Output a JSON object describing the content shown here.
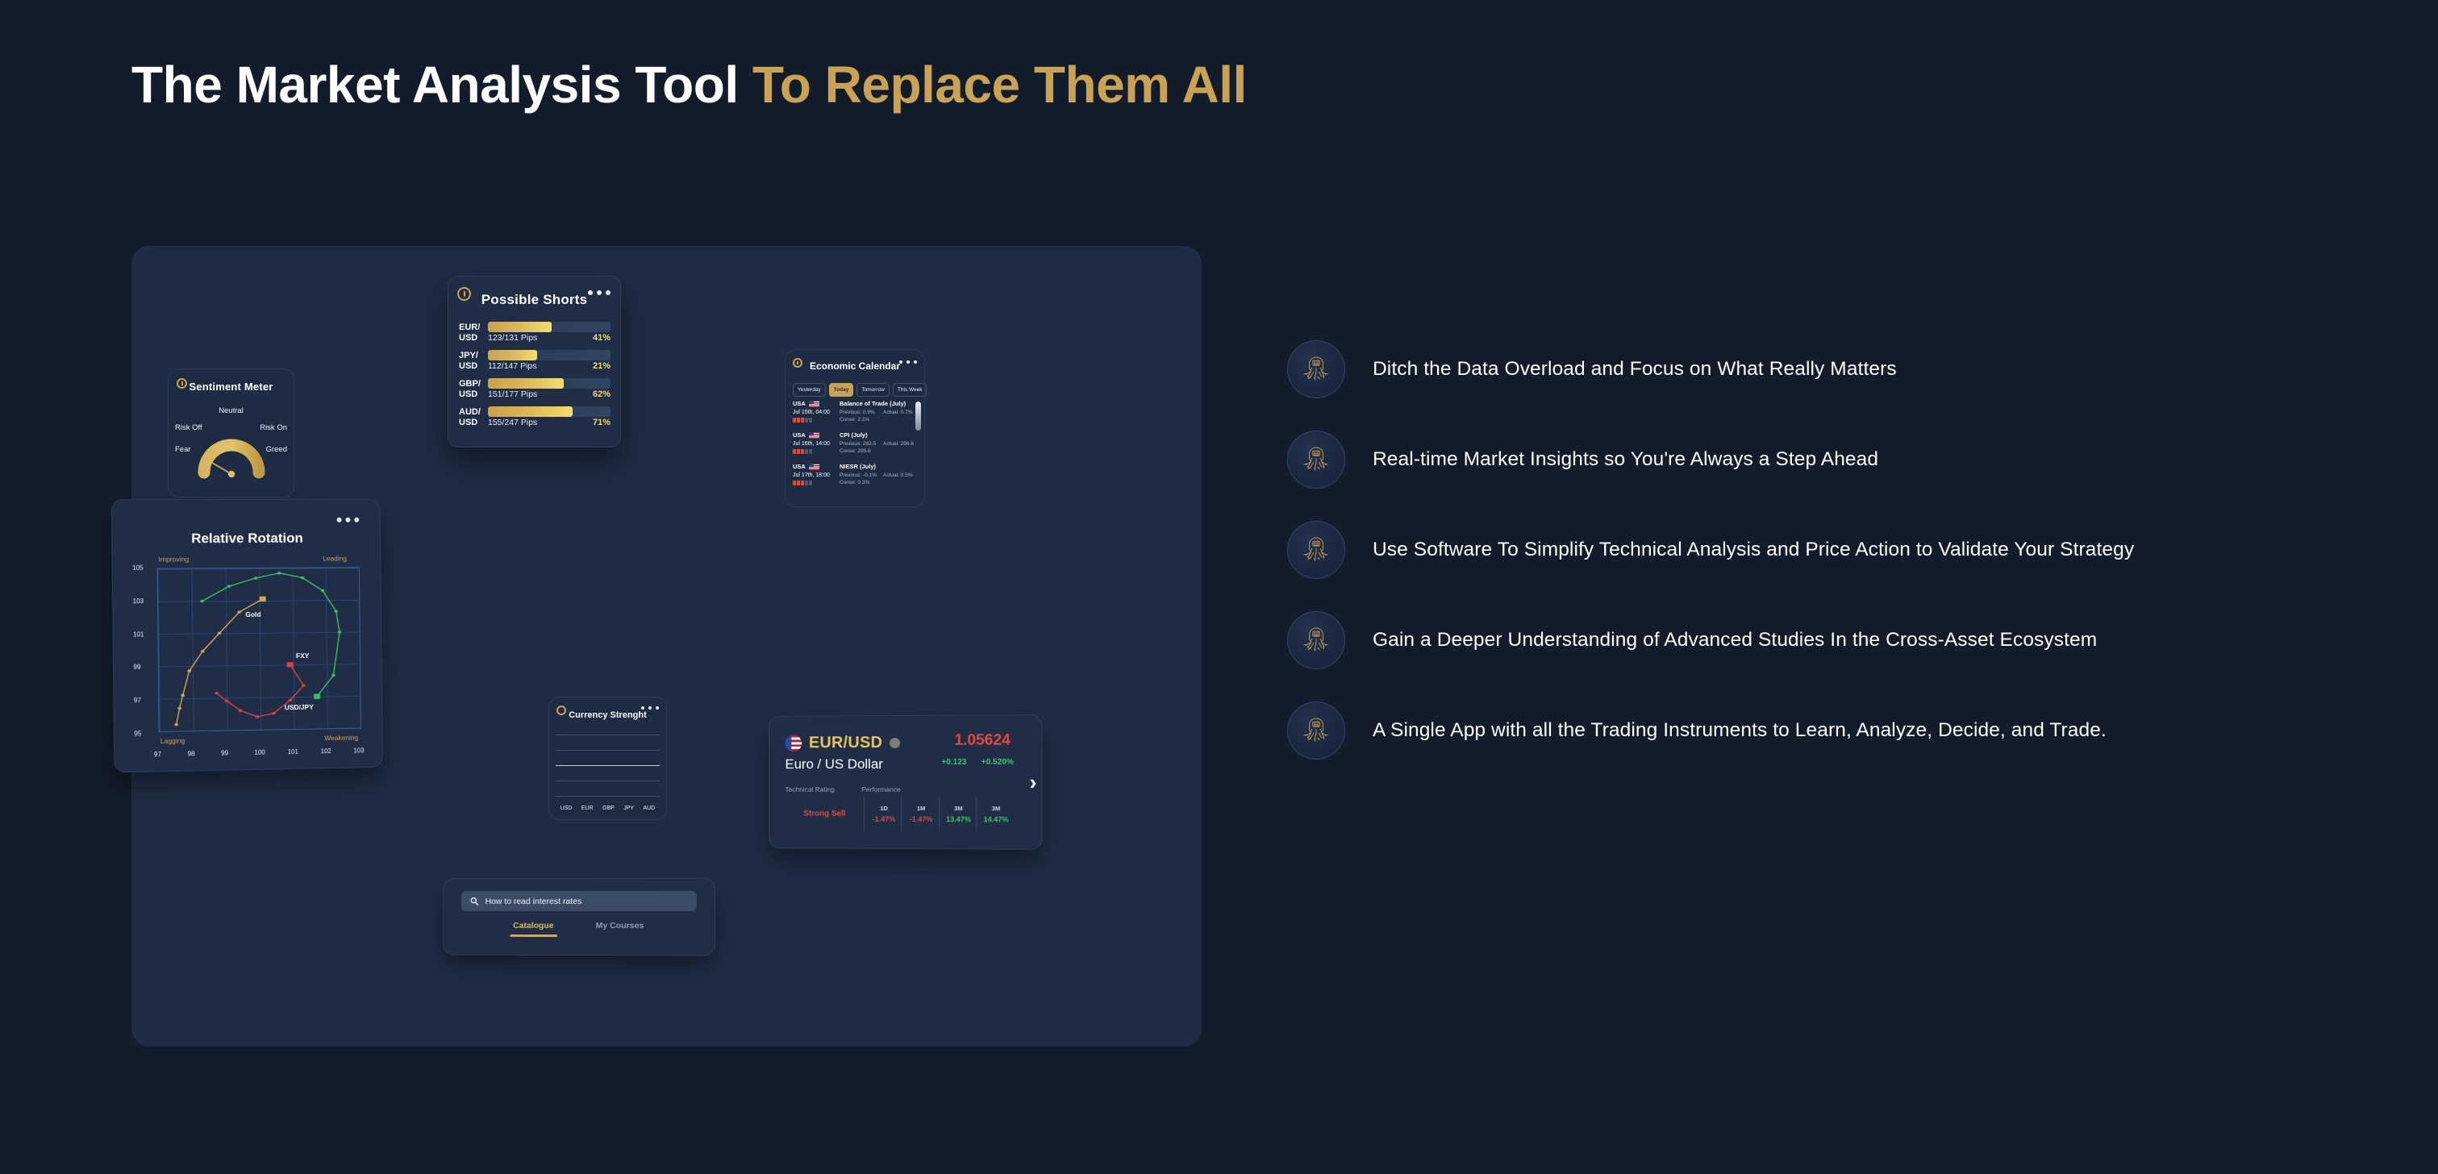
{
  "headline": {
    "lead": "The Market Analysis Tool ",
    "accent": "To Replace Them All"
  },
  "colors": {
    "page_bg": "#131c2b",
    "panel_bg": "#1e2c45",
    "card_bg": "#1d2b43",
    "gold": "#c9a253",
    "gold_bright": "#efd87a",
    "red": "#e04a3f",
    "green": "#3fc96a",
    "text": "#ffffff"
  },
  "features": [
    {
      "icon": "octopus-circuit-icon",
      "text": "Ditch the Data Overload and Focus on What Really Matters"
    },
    {
      "icon": "octopus-circuit-icon",
      "text": "Real-time Market Insights so You're Always a Step Ahead"
    },
    {
      "icon": "octopus-circuit-icon",
      "text": "Use Software To Simplify Technical Analysis and Price Action to Validate Your Strategy"
    },
    {
      "icon": "octopus-circuit-icon",
      "text": "Gain a Deeper Understanding of Advanced Studies In the Cross-Asset Ecosystem"
    },
    {
      "icon": "octopus-circuit-icon",
      "text": "A Single App with all the Trading Instruments to Learn, Analyze, Decide, and Trade."
    }
  ],
  "sentiment_meter": {
    "title": "Sentiment Meter",
    "labels": {
      "neutral": "Neutral",
      "risk_off": "Risk Off",
      "risk_on": "Risk On",
      "fear": "Fear",
      "greed": "Greed"
    }
  },
  "possible_shorts": {
    "title": "Possible Shorts",
    "rows": [
      {
        "pair_top": "EUR/",
        "pair_bottom": "USD",
        "pips": "123/131 Pips",
        "percent": "41%",
        "fill": 52
      },
      {
        "pair_top": "JPY/",
        "pair_bottom": "USD",
        "pips": "112/147 Pips",
        "percent": "21%",
        "fill": 40
      },
      {
        "pair_top": "GBP/",
        "pair_bottom": "USD",
        "pips": "151/177 Pips",
        "percent": "62%",
        "fill": 62
      },
      {
        "pair_top": "AUD/",
        "pair_bottom": "USD",
        "pips": "155/247 Pips",
        "percent": "71%",
        "fill": 69
      }
    ]
  },
  "economic_calendar": {
    "title": "Economic Calendar",
    "tabs": [
      {
        "label": "Yesterday",
        "active": false
      },
      {
        "label": "Today",
        "active": true
      },
      {
        "label": "Tomorrow",
        "active": false
      },
      {
        "label": "This Week",
        "active": false
      }
    ],
    "events": [
      {
        "country": "USA",
        "time": "Jul 15th, 04:00",
        "impact": 3,
        "title": "Balance of Trade (July)",
        "previous": "Previous: 0.9%",
        "actual": "Actual: 0.7%",
        "consensus": "Conse: 2.1%"
      },
      {
        "country": "USA",
        "time": "Jul 16th, 14:00",
        "impact": 3,
        "title": "CPI (July)",
        "previous": "Previous: 292.5",
        "actual": "Actual: 296.6",
        "consensus": "Conse: 295.6"
      },
      {
        "country": "USA",
        "time": "Jul 17th, 18:00",
        "impact": 3,
        "title": "NIESR (July)",
        "previous": "Previous: -0.1%",
        "actual": "Actual: 0.5%",
        "consensus": "Conse: 0.2%"
      }
    ]
  },
  "relative_rotation": {
    "title": "Relative Rotation",
    "quadrants": {
      "improving": "Improving",
      "leading": "Leading",
      "lagging": "Lagging",
      "weakening": "Weakening"
    },
    "point_labels": [
      {
        "name": "Gold",
        "color": "#e0b24e"
      },
      {
        "name": "FXY",
        "color": "#e04a3f"
      },
      {
        "name": "USD/JPY",
        "color": "#3fc96a"
      }
    ],
    "chart_data": {
      "type": "scatter",
      "title": "Relative Rotation",
      "xlabel": "",
      "ylabel": "",
      "xlim": [
        97,
        103
      ],
      "ylim": [
        95,
        105
      ],
      "xticks": [
        "97",
        "98",
        "99",
        "100",
        "101",
        "102",
        "103"
      ],
      "yticks": [
        "95",
        "97",
        "99",
        "101",
        "103",
        "105"
      ],
      "grid": true,
      "legend": "none",
      "series": [
        {
          "name": "Gold",
          "color": "#d8a84a",
          "marker": "square-end",
          "points": [
            [
              97.5,
              95.4
            ],
            [
              97.6,
              96.4
            ],
            [
              97.7,
              97.2
            ],
            [
              97.9,
              98.7
            ],
            [
              98.3,
              99.9
            ],
            [
              98.8,
              101.0
            ],
            [
              99.4,
              102.3
            ],
            [
              100.1,
              103.1
            ]
          ]
        },
        {
          "name": "USD/JPY",
          "color": "#3cc063",
          "marker": "square-end",
          "points": [
            [
              98.3,
              103.0
            ],
            [
              99.1,
              103.9
            ],
            [
              99.9,
              104.4
            ],
            [
              100.6,
              104.7
            ],
            [
              101.3,
              104.4
            ],
            [
              101.9,
              103.6
            ],
            [
              102.3,
              102.3
            ],
            [
              102.4,
              101.0
            ],
            [
              102.2,
              98.3
            ],
            [
              101.7,
              97.0
            ]
          ]
        },
        {
          "name": "FXY",
          "color": "#d9453a",
          "marker": "square-end",
          "points": [
            [
              98.7,
              97.3
            ],
            [
              99.0,
              96.8
            ],
            [
              99.4,
              96.2
            ],
            [
              99.9,
              95.8
            ],
            [
              100.4,
              96.0
            ],
            [
              100.9,
              96.8
            ],
            [
              101.3,
              97.7
            ],
            [
              100.9,
              99.0
            ]
          ]
        }
      ]
    }
  },
  "currency_strength": {
    "title": "Currency Strenght",
    "axis": [
      "USD",
      "EUR",
      "GBP",
      "JPY",
      "AUD"
    ],
    "chart_data": {
      "type": "line",
      "title": "Currency Strenght",
      "categories": [
        "USD",
        "EUR",
        "GBP",
        "JPY",
        "AUD"
      ],
      "series": [],
      "grid": true,
      "ylabel": "",
      "xlabel": ""
    }
  },
  "quote_card": {
    "symbol": "EUR/USD",
    "name": "Euro / US Dollar",
    "price": "1.05624",
    "change_abs": "+0.123",
    "change_pct": "+0.520%",
    "technical_rating_label": "Technical Rating",
    "performance_label": "Performance",
    "rating": "Strong Sell",
    "performance": [
      {
        "period": "1D",
        "value": "-1.47%",
        "dir": "neg"
      },
      {
        "period": "1M",
        "value": "-1.47%",
        "dir": "neg"
      },
      {
        "period": "3M",
        "value": "13.47%",
        "dir": "pos"
      },
      {
        "period": "3M",
        "value": "14.47%",
        "dir": "pos"
      }
    ],
    "next_icon": "chevron-right-icon"
  },
  "courses_card": {
    "search_value": "How to read interest rates",
    "search_icon": "search-icon",
    "tabs": [
      {
        "label": "Catalogue",
        "active": true
      },
      {
        "label": "My Courses",
        "active": false
      }
    ]
  }
}
